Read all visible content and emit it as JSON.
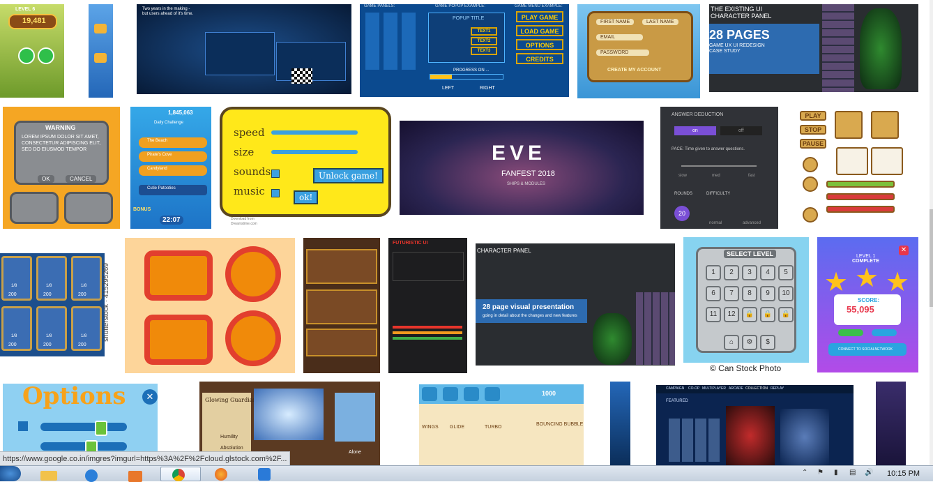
{
  "tiles": {
    "t1": {
      "level": "LEVEL 6",
      "score": "19,481"
    },
    "t3": {
      "caption_a": "Two years in the making -",
      "caption_b": "but users ahead of it's time."
    },
    "t4": {
      "header_left": "GAME PANELS:",
      "header_mid": "GAME POPUP EXAMPLE:",
      "header_right": "GAME MENU EXAMPLE:",
      "popup_title": "POPUP TITLE",
      "text1": "TEXT1",
      "text2": "TEXT2",
      "text3": "TEXT3",
      "progress": "PROGRESS ON ...",
      "left": "LEFT",
      "right": "RIGHT",
      "menu": [
        "PLAY GAME",
        "LOAD GAME",
        "OPTIONS",
        "CREDITS"
      ]
    },
    "t5": {
      "first": "FIRST NAME",
      "last": "LAST NAME",
      "email": "EMAIL",
      "password": "PASSWORD",
      "create": "CREATE MY ACCOUNT"
    },
    "t6": {
      "top": "THE EXISTING UI",
      "panel": "CHARACTER PANEL",
      "pages": "28 PAGES",
      "sub1": "GAME UX UI REDESIGN",
      "sub2": "CASE STUDY"
    },
    "t7": {
      "warning": "WARNING",
      "body": "LOREM IPSUM DOLOR SIT AMET, CONSECTETUR ADIPISCING ELIT, SED DO EIUSMOD TEMPOR",
      "ok": "OK",
      "cancel": "CANCEL"
    },
    "t8": {
      "coins": "1,845,063",
      "title": "Daily Challenge",
      "items": [
        "The Beach",
        "Pirate's Cove",
        "Candyland",
        "Cutie Patooties"
      ],
      "bonus": "BONUS",
      "timer": "22:07"
    },
    "t9": {
      "speed": "speed",
      "size": "size",
      "sounds": "sounds",
      "music": "music",
      "unlock": "Unlock game!",
      "ok": "ok!",
      "download": "Download from",
      "site": "Dreamstime.com"
    },
    "t10": {
      "logo": "EVE",
      "fanfest": "FANFEST 2018",
      "sub": "SHIPS & MODULES"
    },
    "t11": {
      "answer": "ANSWER DEDUCTION",
      "on": "on",
      "off": "off",
      "pace": "PACE: Time given to answer questions.",
      "slow": "slow",
      "med": "med",
      "fast": "fast",
      "rounds": "ROUNDS",
      "difficulty": "DIFFICULTY",
      "rounds_val": "20",
      "normal": "normal",
      "advanced": "advanced"
    },
    "t12": {
      "play": "PLAY",
      "stop": "STOP",
      "pause": "PAUSE"
    },
    "t13": {
      "watermark": "shutterstock · 415295269",
      "values": [
        "1/8",
        "1/8",
        "1/8",
        "1/8",
        "1/8",
        "1/8"
      ],
      "prices": [
        "200",
        "200",
        "200",
        "200",
        "200",
        "200"
      ]
    },
    "t16": {
      "title": "FUTURISTIC UI"
    },
    "t17": {
      "panel": "CHARACTER PANEL",
      "pres": "28 page visual presentation",
      "sub": "going in detail about the changes and new features"
    },
    "t18": {
      "title": "SELECT LEVEL",
      "levels": [
        "1",
        "2",
        "3",
        "4",
        "5",
        "6",
        "7",
        "8",
        "9",
        "10",
        "11",
        "12"
      ],
      "credit": "© Can Stock Photo"
    },
    "t19": {
      "level": "LEVEL 1",
      "complete": "COMPLETE",
      "score_label": "SCORE:",
      "score": "55,095",
      "connect": "CONNECT TO SOCIALNETWORK"
    },
    "t20": {
      "title": "Options"
    },
    "t21": {
      "name": "Glowing Guardian",
      "humility": "Humility",
      "absolution": "Absolution",
      "alone": "Alone"
    },
    "t22": {
      "coins": "1000",
      "wings": "WINGS",
      "glide": "GLIDE",
      "turbo": "TURBO",
      "bubble": "BOUNCING BUBBLE"
    },
    "t24": {
      "nav": [
        "CAMPAIGN",
        "CO-OP",
        "MULTIPLAYER",
        "ARCADE",
        "COLLECTION",
        "REPLAY"
      ],
      "featured": "FEATURED"
    }
  },
  "status_url": "https://www.google.co.in/imgres?imgurl=https%3A%2F%2Fcloud.glstock.com%2F...",
  "taskbar": {
    "time": "10:15 PM"
  },
  "colors": {
    "taskbar": "#c5d1de",
    "accent_gold": "#ffc21a"
  }
}
